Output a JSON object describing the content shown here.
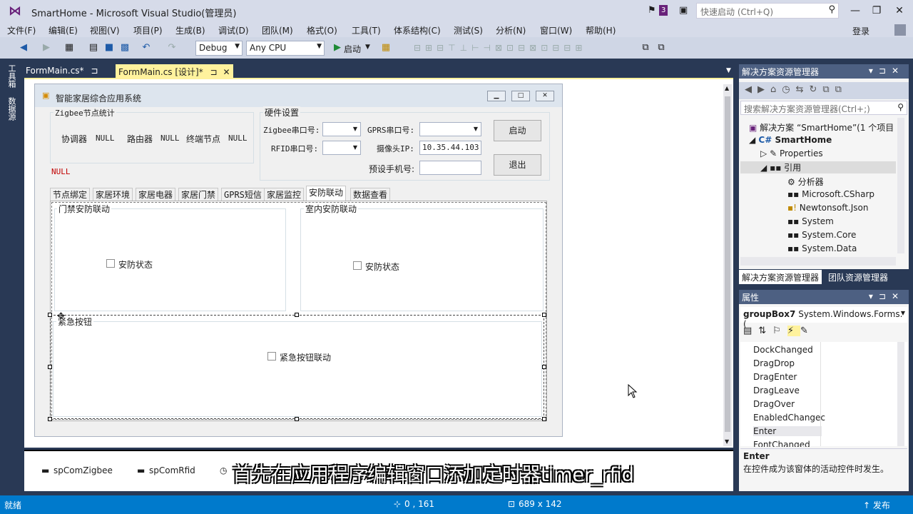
{
  "window": {
    "title": "SmartHome - Microsoft Visual Studio(管理员)",
    "notif_count": "3",
    "quick_launch_placeholder": "快速启动 (Ctrl+Q)",
    "minimize": "—",
    "restore": "❐",
    "close": "✕"
  },
  "menu": [
    "文件(F)",
    "编辑(E)",
    "视图(V)",
    "项目(P)",
    "生成(B)",
    "调试(D)",
    "团队(M)",
    "格式(O)",
    "工具(T)",
    "体系结构(C)",
    "测试(S)",
    "分析(N)",
    "窗口(W)",
    "帮助(H)"
  ],
  "login": "登录",
  "toolbar": {
    "config": "Debug",
    "platform": "Any CPU",
    "start": "启动"
  },
  "left_strip": [
    "工具箱",
    "数据源"
  ],
  "doc_tabs": [
    {
      "label": "FormMain.cs*",
      "pin": "⊐"
    },
    {
      "label": "FormMain.cs [设计]*",
      "pin": "⊐",
      "close": "✕"
    }
  ],
  "form": {
    "title": "智能家居综合应用系统",
    "zigbee_group": {
      "title": "Zigbee节点统计",
      "coordinator": "协调器",
      "coordinator_val": "NULL",
      "router": "路由器",
      "router_val": "NULL",
      "terminal": "终端节点",
      "terminal_val": "NULL"
    },
    "status_null": "NULL",
    "hw_group": {
      "title": "硬件设置",
      "zigbee_port": "Zigbee串口号:",
      "gprs_port": "GPRS串口号:",
      "rfid_port": "RFID串口号:",
      "camera_ip": "摄像头IP:",
      "camera_ip_val": "10.35.44.103",
      "phone": "预设手机号:"
    },
    "btn_start": "启动",
    "btn_exit": "退出",
    "tabs": [
      "节点绑定",
      "家居环境",
      "家居电器",
      "家居门禁",
      "GPRS短信",
      "家居监控",
      "安防联动",
      "数据查看"
    ],
    "active_tab": "安防联动",
    "door_group": {
      "title": "门禁安防联动",
      "checkbox": "安防状态"
    },
    "indoor_group": {
      "title": "室内安防联动",
      "checkbox": "安防状态"
    },
    "emergency_group": {
      "title": "紧急按钮",
      "checkbox": "紧急按钮联动"
    }
  },
  "tray": [
    "spComZigbee",
    "spComRfid"
  ],
  "subtitle": "首先在应用程序编辑窗口添加定时器timer_rfid",
  "solution_explorer": {
    "header": "解决方案资源管理器",
    "search_placeholder": "搜索解决方案资源管理器(Ctrl+;)",
    "items": [
      {
        "label": "解决方案 “SmartHome”(1 个项目"
      },
      {
        "label": "SmartHome"
      },
      {
        "label": "Properties"
      },
      {
        "label": "引用"
      },
      {
        "label": "分析器"
      },
      {
        "label": "Microsoft.CSharp"
      },
      {
        "label": "Newtonsoft.Json"
      },
      {
        "label": "System"
      },
      {
        "label": "System.Core"
      },
      {
        "label": "System.Data"
      }
    ],
    "bottom_tabs": [
      "解决方案资源管理器",
      "团队资源管理器"
    ]
  },
  "properties": {
    "header": "属性",
    "object": "groupBox7",
    "object_type": "System.Windows.Forms.(",
    "events": [
      "DockChanged",
      "DragDrop",
      "DragEnter",
      "DragLeave",
      "DragOver",
      "EnabledChangec",
      "Enter",
      "FontChanged"
    ],
    "desc_title": "Enter",
    "desc_text": "在控件成为该窗体的活动控件时发生。"
  },
  "status": {
    "ready": "就绪",
    "position": "0 , 161",
    "size": "689 x 142",
    "publish": "↑ 发布"
  },
  "colors": {
    "accent": "#007acc",
    "tab_active": "#fff29d",
    "panel_header": "#4d6082"
  }
}
